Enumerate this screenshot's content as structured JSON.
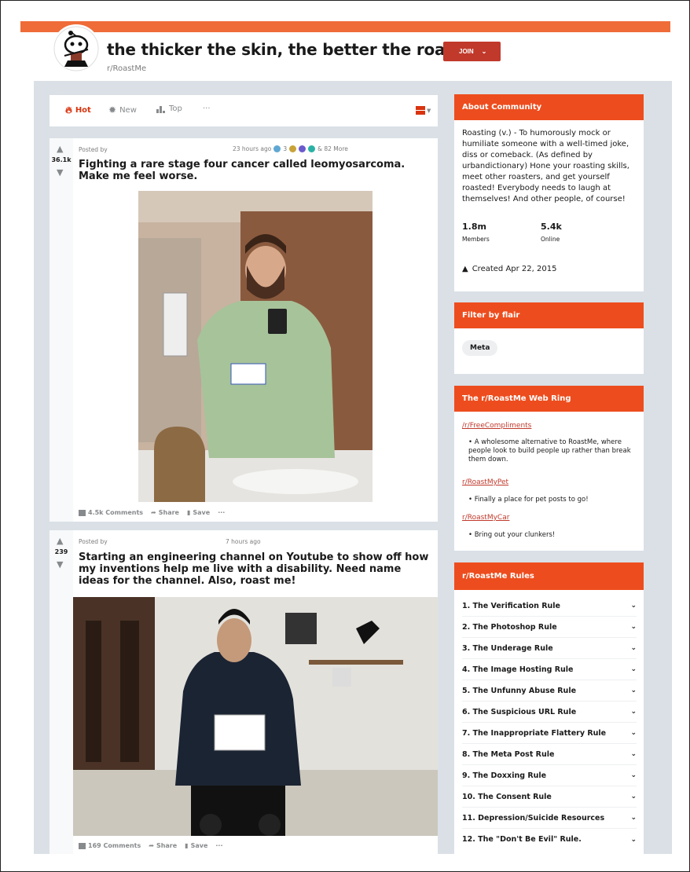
{
  "header": {
    "title": "the thicker the skin, the better the roast",
    "subreddit": "r/RoastMe",
    "join_label": "JOIN"
  },
  "sortbar": {
    "items": [
      {
        "label": "Hot",
        "icon": "flame-icon",
        "active": true
      },
      {
        "label": "New",
        "icon": "burst-icon",
        "active": false
      },
      {
        "label": "Top",
        "icon": "bars-icon",
        "active": false
      },
      {
        "label": "···",
        "icon": "",
        "active": false
      }
    ]
  },
  "posts": [
    {
      "score": "36.1k",
      "posted_by": "Posted by",
      "time": "23 hours ago",
      "award_count": "3",
      "more_awards": "& 82 More",
      "title": "Fighting a rare stage four cancer called leomyosarcoma. Make me feel worse.",
      "comments": "4.5k Comments",
      "share": "Share",
      "save": "Save",
      "more": "···"
    },
    {
      "score": "239",
      "posted_by": "Posted by",
      "time": "7 hours ago",
      "title": "Starting an engineering channel on Youtube to show off how my inventions help me live with a disability. Need name ideas for the channel. Also, roast me!",
      "comments": "169 Comments",
      "share": "Share",
      "save": "Save",
      "more": "···"
    }
  ],
  "about": {
    "heading": "About Community",
    "description": "Roasting (v.) - To humorously mock or humiliate someone with a well-timed joke, diss or comeback. (As defined by urbandictionary) Hone your roasting skills, meet other roasters, and get yourself roasted! Everybody needs to laugh at themselves! And other people, of course!",
    "members_count": "1.8m",
    "members_label": "Members",
    "online_count": "5.4k",
    "online_label": "Online",
    "created": "Created Apr 22, 2015"
  },
  "filter": {
    "heading": "Filter by flair",
    "flair": "Meta"
  },
  "webring": {
    "heading": "The r/RoastMe Web Ring",
    "links": [
      {
        "name": "/r/FreeCompliments",
        "desc": "A wholesome alternative to RoastMe, where people look to build people up rather than break them down."
      },
      {
        "name": "r/RoastMyPet",
        "desc": "Finally a place for pet posts to go!"
      },
      {
        "name": "r/RoastMyCar",
        "desc": "Bring out your clunkers!"
      }
    ]
  },
  "rules": {
    "heading": "r/RoastMe Rules",
    "items": [
      "1. The Verification Rule",
      "2. The Photoshop Rule",
      "3. The Underage Rule",
      "4. The Image Hosting Rule",
      "5. The Unfunny Abuse Rule",
      "6. The Suspicious URL Rule",
      "7. The Inappropriate Flattery Rule",
      "8. The Meta Post Rule",
      "9. The Doxxing Rule",
      "10. The Consent Rule",
      "11. Depression/Suicide Resources",
      "12. The \"Don't Be Evil\" Rule."
    ]
  },
  "colors": {
    "accent": "#ed4d1e",
    "banner": "#ef6c39",
    "join": "#c0392b",
    "page_bg": "#dae0e6"
  }
}
